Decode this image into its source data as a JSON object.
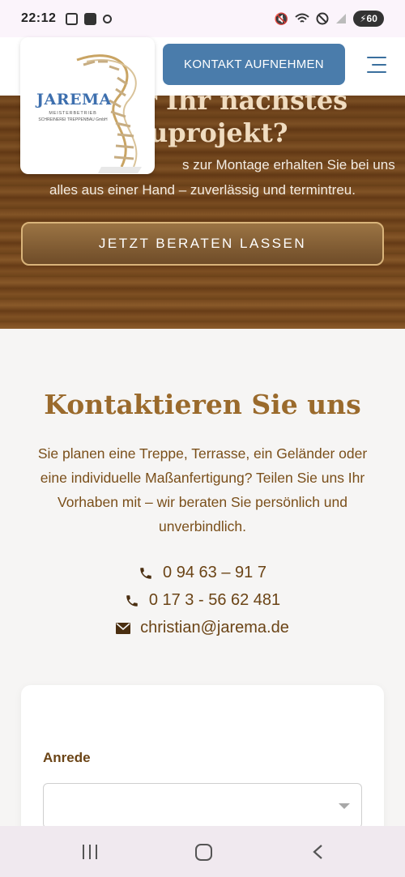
{
  "status_bar": {
    "time": "22:12",
    "battery": "60",
    "left_icons": [
      "screenshot-icon",
      "checkbox-icon",
      "accessibility-icon"
    ],
    "right_icons": [
      "mute-icon",
      "wifi-icon",
      "do-not-disturb-icon",
      "signal-icon",
      "battery-charging-icon"
    ]
  },
  "header": {
    "logo": {
      "wordmark": "JAREMA",
      "line1": "MEISTERBETRIEB",
      "line2": "SCHREINEREI TREPPENBAU GmbH"
    },
    "contact_button": "KONTAKT AUFNEHMEN",
    "menu_icon": "hamburger-menu-icon",
    "accent_color": "#4a7cab"
  },
  "hero": {
    "title_line1": "für Ihr nächstes",
    "title_line2": "uprojekt?",
    "text_line1": "s zur Montage erhalten Sie bei uns",
    "text_line2": "alles aus einer Hand – zuverlässig und termintreu.",
    "cta": "JETZT BERATEN LASSEN"
  },
  "contact": {
    "title": "Kontaktieren Sie uns",
    "text": "Sie planen eine Treppe, Terrasse, ein Geländer oder eine individuelle Maßanfertigung? Teilen Sie uns Ihr Vorhaben mit – wir beraten Sie persönlich und unverbindlich.",
    "phone1": "0 94 63 – 91 7",
    "phone2": "0 17 3 - 56 62 481",
    "email": "christian@jarema.de",
    "title_color": "#9a6a2c"
  },
  "form": {
    "salutation_label": "Anrede",
    "salutation_value": ""
  },
  "nav_bar": {
    "icons": [
      "recent-apps-icon",
      "home-icon",
      "back-icon"
    ]
  }
}
